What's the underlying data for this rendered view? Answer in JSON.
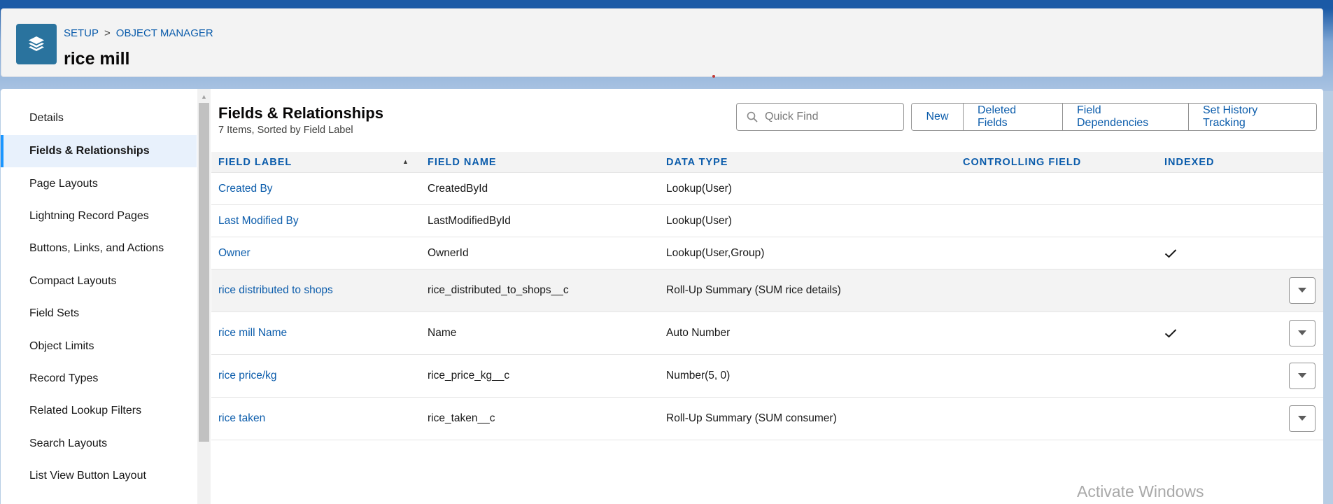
{
  "header": {
    "breadcrumb": [
      "SETUP",
      ">",
      "OBJECT MANAGER"
    ],
    "title": "rice mill",
    "icon": "stack-layers-icon"
  },
  "nav": {
    "active": "Fields & Relationships",
    "items": [
      {
        "label": "Details"
      },
      {
        "label": "Fields & Relationships"
      },
      {
        "label": "Page Layouts"
      },
      {
        "label": "Lightning Record Pages"
      },
      {
        "label": "Buttons, Links, and Actions"
      },
      {
        "label": "Compact Layouts"
      },
      {
        "label": "Field Sets"
      },
      {
        "label": "Object Limits"
      },
      {
        "label": "Record Types"
      },
      {
        "label": "Related Lookup Filters"
      },
      {
        "label": "Search Layouts"
      },
      {
        "label": "List View Button Layout"
      }
    ]
  },
  "section": {
    "title": "Fields & Relationships",
    "subtitle": "7 Items, Sorted by Field Label"
  },
  "search": {
    "placeholder": "Quick Find",
    "value": ""
  },
  "actions": [
    "New",
    "Deleted Fields",
    "Field Dependencies",
    "Set History Tracking"
  ],
  "table": {
    "columns": [
      "FIELD LABEL",
      "FIELD NAME",
      "DATA TYPE",
      "CONTROLLING FIELD",
      "INDEXED"
    ],
    "sorted_by": "FIELD LABEL",
    "sort_direction": "ascending",
    "rows": [
      {
        "label": "Created By",
        "name": "CreatedById",
        "type": "Lookup(User)",
        "controlling": "",
        "indexed": false,
        "menu": false
      },
      {
        "label": "Last Modified By",
        "name": "LastModifiedById",
        "type": "Lookup(User)",
        "controlling": "",
        "indexed": false,
        "menu": false
      },
      {
        "label": "Owner",
        "name": "OwnerId",
        "type": "Lookup(User,Group)",
        "controlling": "",
        "indexed": true,
        "menu": false
      },
      {
        "label": "rice distributed to shops",
        "name": "rice_distributed_to_shops__c",
        "type": "Roll-Up Summary (SUM rice details)",
        "controlling": "",
        "indexed": false,
        "menu": true
      },
      {
        "label": "rice mill Name",
        "name": "Name",
        "type": "Auto Number",
        "controlling": "",
        "indexed": true,
        "menu": true
      },
      {
        "label": "rice price/kg",
        "name": "rice_price_kg__c",
        "type": "Number(5, 0)",
        "controlling": "",
        "indexed": false,
        "menu": true
      },
      {
        "label": "rice taken",
        "name": "rice_taken__c",
        "type": "Roll-Up Summary (SUM consumer)",
        "controlling": "",
        "indexed": false,
        "menu": true
      }
    ]
  },
  "watermark": "Activate Windows",
  "colors": {
    "link": "#0b5cab",
    "icon_bg": "#2a739e",
    "active_nav_bg": "#e8f1fc",
    "active_nav_border": "#1b96ff"
  }
}
